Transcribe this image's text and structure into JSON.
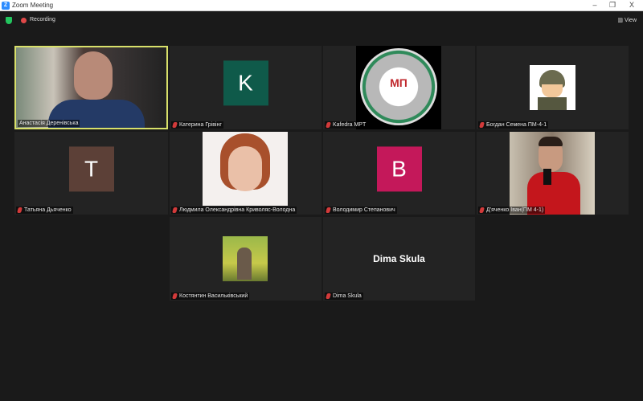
{
  "window": {
    "title": "Zoom Meeting",
    "minimize": "–",
    "maximize": "❐",
    "close": "X"
  },
  "toolbar": {
    "recording": "Recording",
    "view": "View"
  },
  "participants": [
    {
      "name": "Анастасія Деренівська",
      "type": "video",
      "muted": false,
      "active": true
    },
    {
      "name": "Катерина Грівінг",
      "type": "initial",
      "initial": "K",
      "color": "#0f5a4a",
      "muted": true
    },
    {
      "name": "Kafedra MPT",
      "type": "logo",
      "muted": true
    },
    {
      "name": "Богдан Семена ПМ-4-1",
      "type": "picture",
      "muted": true
    },
    {
      "name": "Татьяна Дьяченко",
      "type": "initial",
      "initial": "T",
      "color": "#5c4037",
      "muted": true
    },
    {
      "name": "Людмила Олександрівна Криволяс-Володна",
      "type": "picture",
      "muted": true
    },
    {
      "name": "Володимир Степанович",
      "type": "initial",
      "initial": "B",
      "color": "#c4185a",
      "muted": true
    },
    {
      "name": "Д'яченко Іван(ПМ 4-1)",
      "type": "picture",
      "muted": true
    },
    {
      "name": "Костянтин Васильківський",
      "type": "picture",
      "muted": true
    },
    {
      "name": "Dima Skula",
      "type": "name",
      "muted": true
    }
  ]
}
